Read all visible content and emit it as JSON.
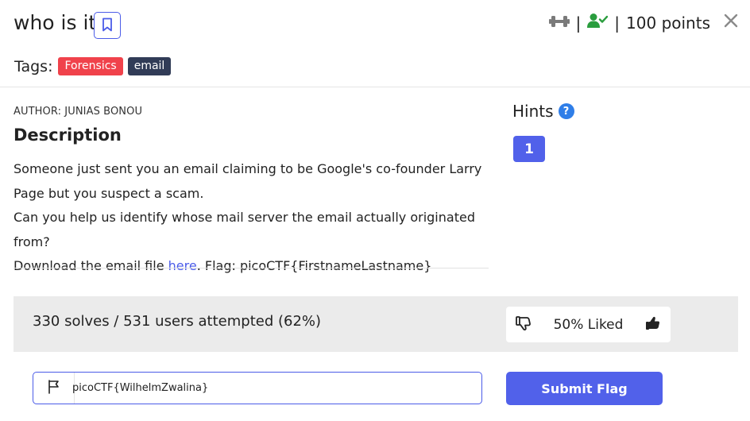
{
  "challenge": {
    "title": "who is it",
    "points": "100 points",
    "separator": "|"
  },
  "tags": {
    "label": "Tags:",
    "items": [
      "Forensics",
      "email"
    ]
  },
  "author": "AUTHOR: JUNIAS BONOU",
  "description": {
    "title": "Description",
    "line1": "Someone just sent you an email claiming to be Google's co-founder Larry Page but you suspect a scam.",
    "line2": "Can you help us identify whose mail server the email actually originated from?",
    "line3_prefix": "Download the email file ",
    "link_text": "here",
    "line3_suffix": ". Flag: picoCTF{FirstnameLastname}"
  },
  "hints": {
    "title": "Hints",
    "help_icon_label": "?",
    "items": [
      "1"
    ]
  },
  "stats": {
    "text": "330 solves / 531 users attempted (62%)",
    "liked": "50% Liked",
    "liked_percent": 50
  },
  "flag_form": {
    "value": "picoCTF{WilhelmZwalina}",
    "submit_label": "Submit Flag"
  },
  "colors": {
    "accent": "#5161ea",
    "tag_forensics": "#f0424b",
    "tag_email": "#313c57",
    "solved_icon": "#2a9d3e",
    "help_icon": "#2f7ee8"
  },
  "icons": {
    "bookmark": "bookmark-icon",
    "difficulty": "dumbbell-icon",
    "solved": "user-check-icon",
    "close": "close-icon",
    "flag": "flag-icon",
    "dislike": "thumbs-down-icon",
    "like": "thumbs-up-icon"
  }
}
